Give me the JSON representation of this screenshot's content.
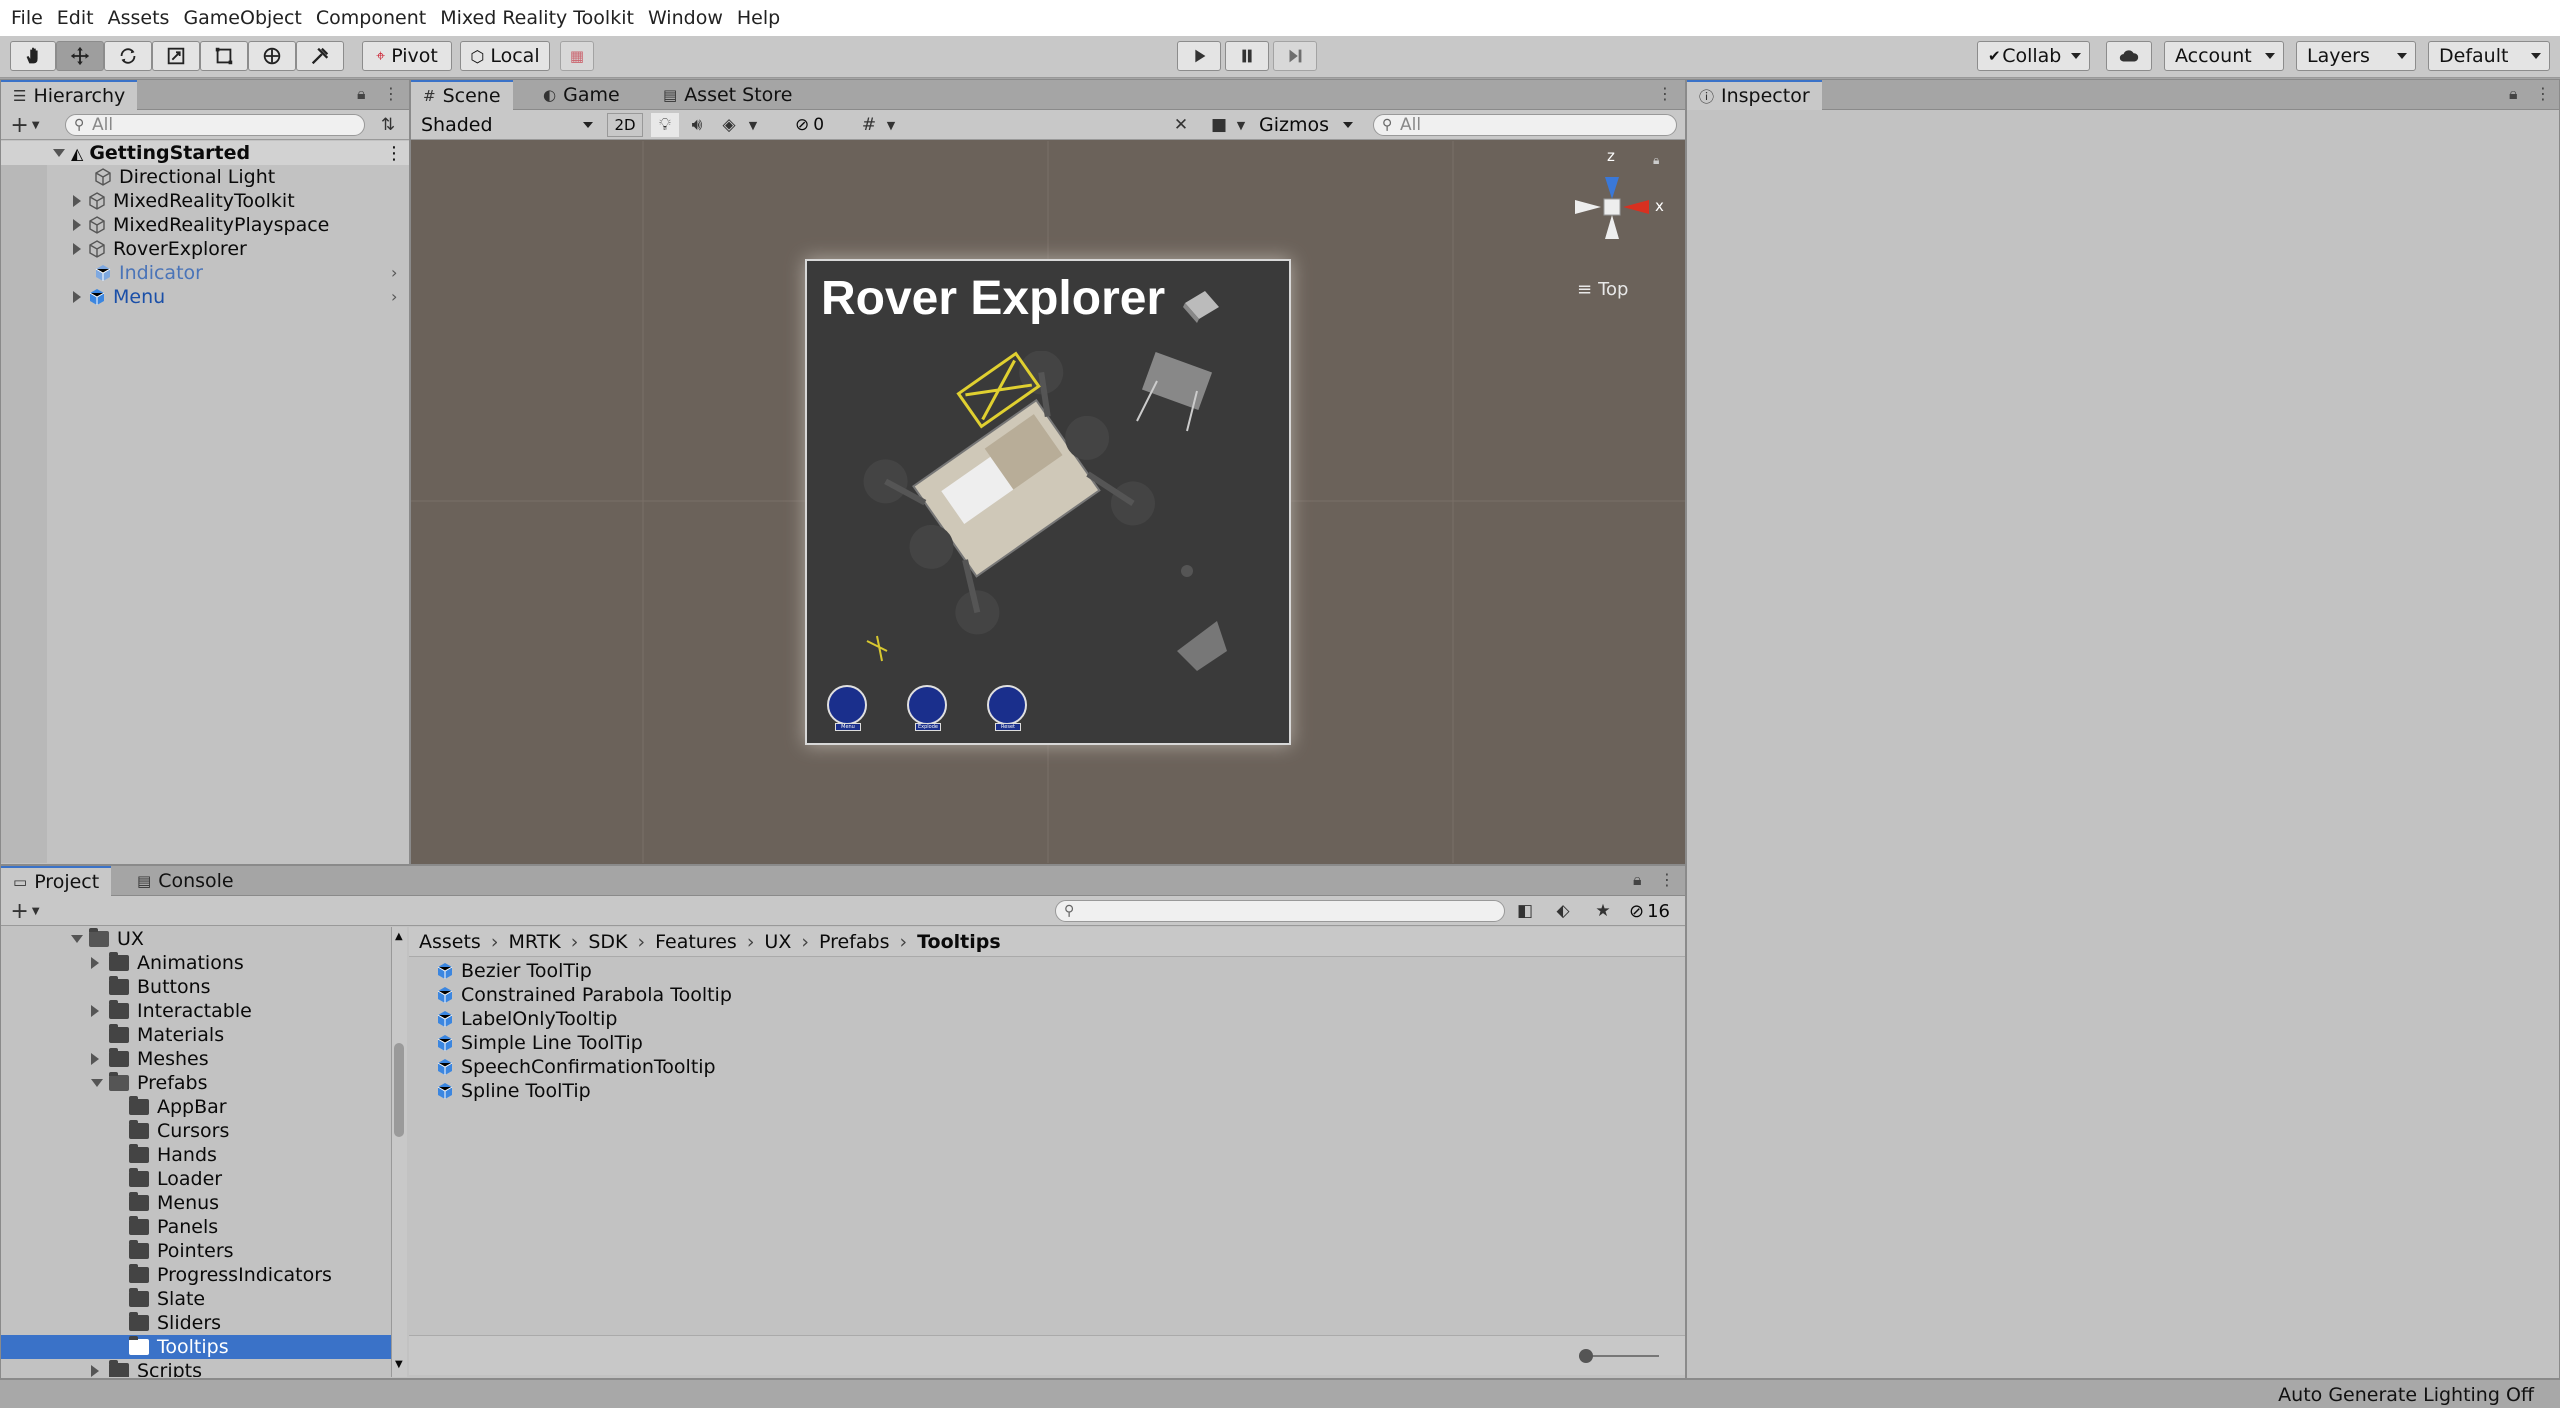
{
  "menu": [
    "File",
    "Edit",
    "Assets",
    "GameObject",
    "Component",
    "Mixed Reality Toolkit",
    "Window",
    "Help"
  ],
  "toolbar": {
    "pivot": "Pivot",
    "local": "Local",
    "collab": "Collab",
    "account": "Account",
    "layers": "Layers",
    "layout": "Default"
  },
  "hierarchy": {
    "tab": "Hierarchy",
    "search_placeholder": "All",
    "scene": "GettingStarted",
    "items": [
      "Directional Light",
      "MixedRealityToolkit",
      "MixedRealityPlayspace",
      "RoverExplorer",
      "Indicator",
      "Menu"
    ]
  },
  "scene": {
    "tabs": [
      "Scene",
      "Game",
      "Asset Store"
    ],
    "shading": "Shaded",
    "mode2d": "2D",
    "hidden_count": "0",
    "gizmos": "Gizmos",
    "search_placeholder": "All",
    "view_label": "Top",
    "axis_y": "z",
    "axis_x": "x",
    "title": "Rover Explorer",
    "button_labels": [
      "Menu",
      "Explode",
      "Reset"
    ]
  },
  "inspector": {
    "tab": "Inspector"
  },
  "project": {
    "tabs": [
      "Project",
      "Console"
    ],
    "hidden_count": "16",
    "tree": [
      {
        "label": "UX",
        "depth": 0,
        "expanded": true,
        "arrow": true
      },
      {
        "label": "Animations",
        "depth": 1,
        "arrow": true
      },
      {
        "label": "Buttons",
        "depth": 1,
        "arrow": false
      },
      {
        "label": "Interactable",
        "depth": 1,
        "arrow": true
      },
      {
        "label": "Materials",
        "depth": 1,
        "arrow": false
      },
      {
        "label": "Meshes",
        "depth": 1,
        "arrow": true
      },
      {
        "label": "Prefabs",
        "depth": 1,
        "expanded": true,
        "arrow": true
      },
      {
        "label": "AppBar",
        "depth": 2
      },
      {
        "label": "Cursors",
        "depth": 2
      },
      {
        "label": "Hands",
        "depth": 2
      },
      {
        "label": "Loader",
        "depth": 2
      },
      {
        "label": "Menus",
        "depth": 2
      },
      {
        "label": "Panels",
        "depth": 2
      },
      {
        "label": "Pointers",
        "depth": 2
      },
      {
        "label": "ProgressIndicators",
        "depth": 2
      },
      {
        "label": "Slate",
        "depth": 2
      },
      {
        "label": "Sliders",
        "depth": 2
      },
      {
        "label": "Tooltips",
        "depth": 2,
        "selected": true
      },
      {
        "label": "Scripts",
        "depth": 1,
        "arrow": true
      }
    ],
    "breadcrumb": [
      "Assets",
      "MRTK",
      "SDK",
      "Features",
      "UX",
      "Prefabs",
      "Tooltips"
    ],
    "assets": [
      "Bezier ToolTip",
      "Constrained Parabola Tooltip",
      "LabelOnlyTooltip",
      "Simple Line ToolTip",
      "SpeechConfirmationTooltip",
      "Spline ToolTip"
    ]
  },
  "status": {
    "lighting": "Auto Generate Lighting Off"
  },
  "colors": {
    "selection": "#3a72c8",
    "scene_bg": "#6b625a",
    "prefab_blue": "#3b86e0"
  }
}
